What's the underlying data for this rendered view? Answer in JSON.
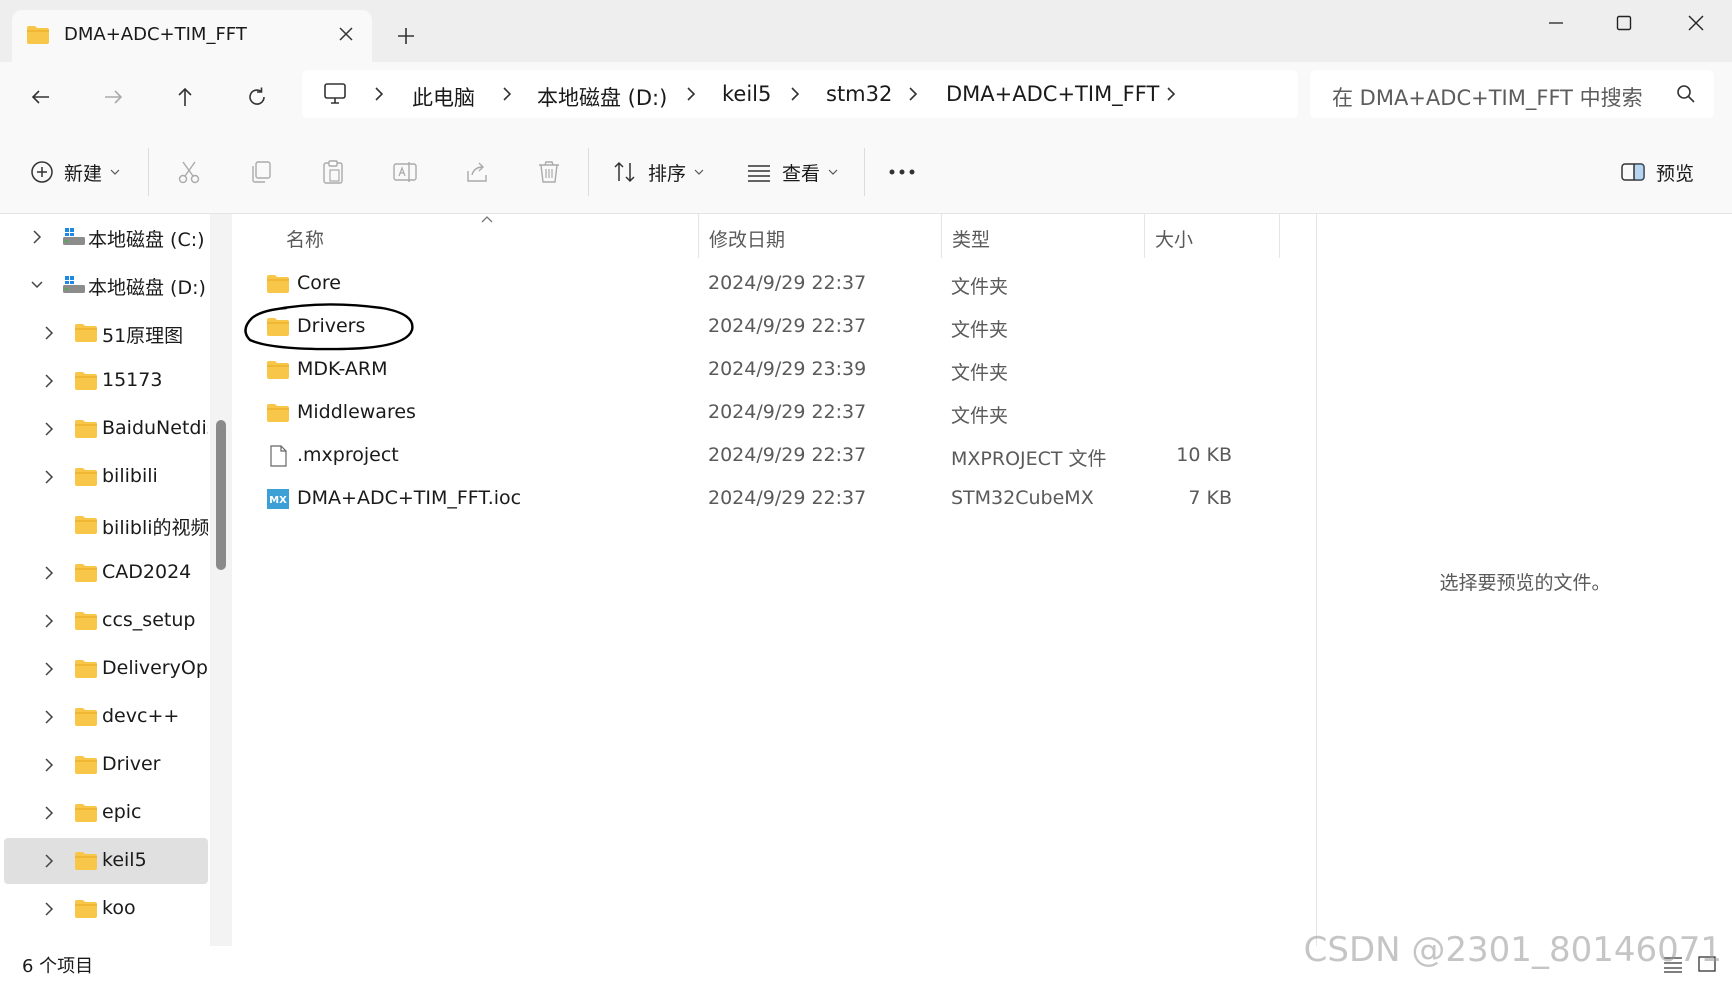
{
  "colors": {
    "folder": "#f8c648",
    "folder_dark": "#e6a820",
    "selected_row": "#e0e0e0",
    "mx_badge": "#3c9fd6",
    "annotation": "#000000"
  },
  "tab": {
    "title": "DMA+ADC+TIM_FFT",
    "icon": "folder-icon"
  },
  "window_controls": [
    "minimize-icon",
    "maximize-icon",
    "close-icon"
  ],
  "breadcrumb": [
    "此电脑",
    "本地磁盘 (D:)",
    "keil5",
    "stm32",
    "DMA+ADC+TIM_FFT"
  ],
  "search": {
    "placeholder": "在 DMA+ADC+TIM_FFT 中搜索"
  },
  "toolbar": {
    "new_label": "新建",
    "sort_label": "排序",
    "view_label": "查看",
    "preview_label": "预览",
    "icons": [
      "cut-icon",
      "copy-icon",
      "paste-icon",
      "rename-icon",
      "share-icon",
      "delete-icon"
    ]
  },
  "sidebar": {
    "items": [
      {
        "label": "本地磁盘 (C:)",
        "kind": "drive",
        "expanded": false,
        "selected": false
      },
      {
        "label": "本地磁盘 (D:)",
        "kind": "drive",
        "expanded": true,
        "selected": false
      },
      {
        "label": "51原理图",
        "kind": "folder",
        "selected": false
      },
      {
        "label": "15173",
        "kind": "folder",
        "selected": false
      },
      {
        "label": "BaiduNetdis",
        "kind": "folder",
        "selected": false
      },
      {
        "label": "bilibili",
        "kind": "folder",
        "selected": false
      },
      {
        "label": "bilibli的视频",
        "kind": "folder",
        "selected": false,
        "no_chevron": true
      },
      {
        "label": "CAD2024",
        "kind": "folder",
        "selected": false
      },
      {
        "label": "ccs_setup",
        "kind": "folder",
        "selected": false
      },
      {
        "label": "DeliveryOpt",
        "kind": "folder",
        "selected": false
      },
      {
        "label": "devc++",
        "kind": "folder",
        "selected": false
      },
      {
        "label": "Driver",
        "kind": "folder",
        "selected": false
      },
      {
        "label": "epic",
        "kind": "folder",
        "selected": false
      },
      {
        "label": "keil5",
        "kind": "folder",
        "selected": true
      },
      {
        "label": "koo",
        "kind": "folder",
        "selected": false
      }
    ]
  },
  "columns": {
    "name": "名称",
    "date": "修改日期",
    "type": "类型",
    "size": "大小"
  },
  "files": [
    {
      "name": "Core",
      "date": "2024/9/29 22:37",
      "type": "文件夹",
      "size": "",
      "icon": "folder-icon"
    },
    {
      "name": "Drivers",
      "date": "2024/9/29 22:37",
      "type": "文件夹",
      "size": "",
      "icon": "folder-icon",
      "annotated": true
    },
    {
      "name": "MDK-ARM",
      "date": "2024/9/29 23:39",
      "type": "文件夹",
      "size": "",
      "icon": "folder-icon"
    },
    {
      "name": "Middlewares",
      "date": "2024/9/29 22:37",
      "type": "文件夹",
      "size": "",
      "icon": "folder-icon"
    },
    {
      "name": ".mxproject",
      "date": "2024/9/29 22:37",
      "type": "MXPROJECT 文件",
      "size": "10 KB",
      "icon": "document-icon"
    },
    {
      "name": "DMA+ADC+TIM_FFT.ioc",
      "date": "2024/9/29 22:37",
      "type": "STM32CubeMX",
      "size": "7 KB",
      "icon": "stm32cubemx-icon",
      "icon_text": "MX"
    }
  ],
  "preview": {
    "message": "选择要预览的文件。"
  },
  "status": {
    "count": "6 个项目"
  },
  "watermark": "CSDN @2301_80146071"
}
